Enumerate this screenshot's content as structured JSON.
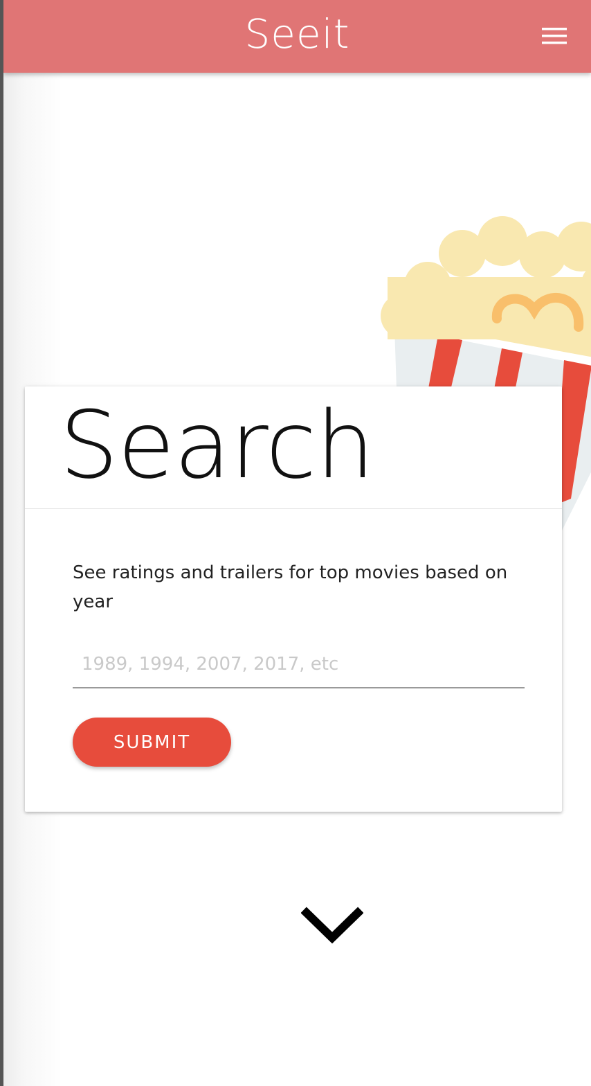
{
  "navbar": {
    "brand": "Seeit",
    "menu_icon": "hamburger-menu-icon",
    "color": "#e07575"
  },
  "hero": {
    "illustration": "popcorn-box-icon"
  },
  "search_card": {
    "title": "Search",
    "description": "See ratings and trailers for top movies based on year",
    "input": {
      "value": "",
      "placeholder": "1989, 1994, 2007, 2017, etc"
    },
    "submit_label": "SUBMIT",
    "accent_color": "#e74c3c"
  },
  "scroll": {
    "icon": "chevron-down-icon"
  }
}
